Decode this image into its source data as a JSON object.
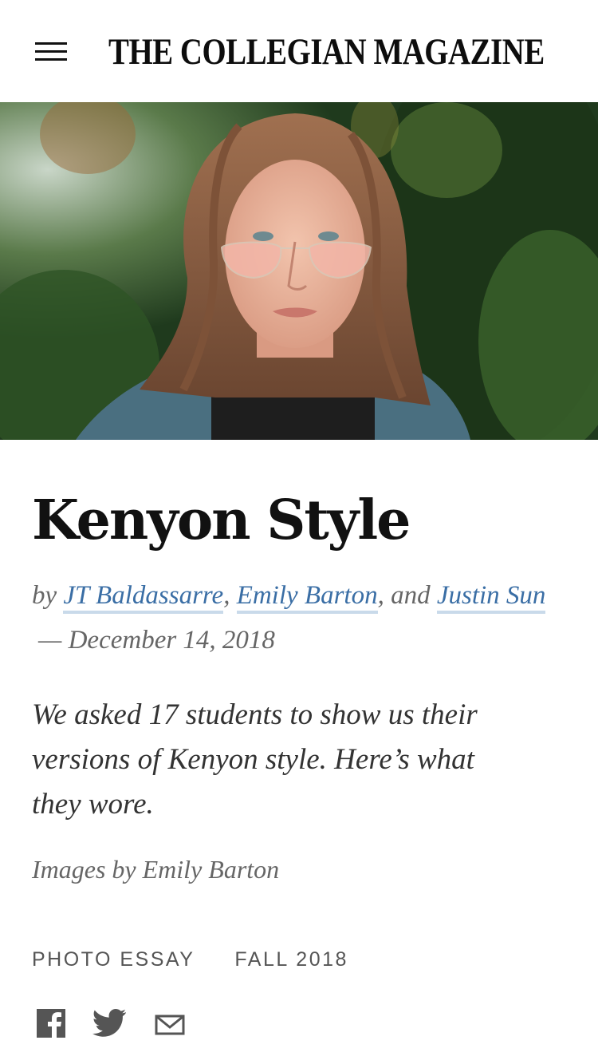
{
  "header": {
    "title": "THE COLLEGIAN MAGAZINE",
    "menu_icon": "hamburger-menu-icon"
  },
  "article": {
    "title": "Kenyon Style",
    "byline_prefix": "by",
    "authors": [
      "JT Baldassarre",
      "Emily Barton",
      "Justin Sun"
    ],
    "separator_comma": ",",
    "separator_and": ", and",
    "date_dash": "—",
    "date": "December 14, 2018",
    "dek": "We asked 17 students to show us their versions of Kenyon style. Here’s what they wore.",
    "photo_credit": "Images by Emily Barton",
    "tags": [
      "PHOTO ESSAY",
      "FALL 2018"
    ]
  },
  "share": {
    "facebook_icon": "facebook-icon",
    "twitter_icon": "twitter-icon",
    "email_icon": "email-icon"
  },
  "colors": {
    "link": "#3a6ea5",
    "link_underline": "#c9daea",
    "meta_text": "#666666"
  }
}
